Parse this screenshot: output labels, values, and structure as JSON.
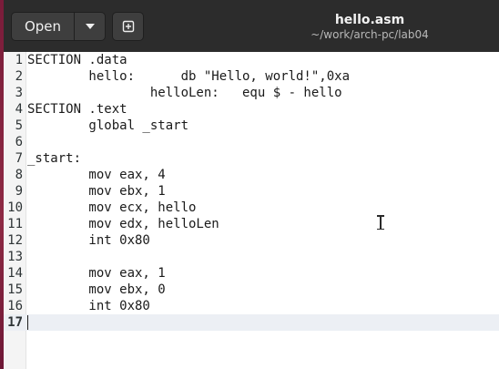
{
  "header": {
    "open_label": "Open",
    "title": "hello.asm",
    "subtitle": "~/work/arch-pc/lab04"
  },
  "icons": {
    "menu": "chevron-down-icon",
    "new_document": "new-document-icon"
  },
  "editor": {
    "current_line": 17,
    "lines": [
      {
        "n": "1",
        "text": "SECTION .data"
      },
      {
        "n": "2",
        "text": "        hello:      db \"Hello, world!\",0xa"
      },
      {
        "n": "3",
        "text": "                helloLen:   equ $ - hello"
      },
      {
        "n": "4",
        "text": "SECTION .text"
      },
      {
        "n": "5",
        "text": "        global _start"
      },
      {
        "n": "6",
        "text": ""
      },
      {
        "n": "7",
        "text": "_start:"
      },
      {
        "n": "8",
        "text": "        mov eax, 4"
      },
      {
        "n": "9",
        "text": "        mov ebx, 1"
      },
      {
        "n": "10",
        "text": "        mov ecx, hello"
      },
      {
        "n": "11",
        "text": "        mov edx, helloLen"
      },
      {
        "n": "12",
        "text": "        int 0x80"
      },
      {
        "n": "13",
        "text": ""
      },
      {
        "n": "14",
        "text": "        mov eax, 1"
      },
      {
        "n": "15",
        "text": "        mov ebx, 0"
      },
      {
        "n": "16",
        "text": "        int 0x80"
      },
      {
        "n": "17",
        "text": ""
      }
    ]
  }
}
